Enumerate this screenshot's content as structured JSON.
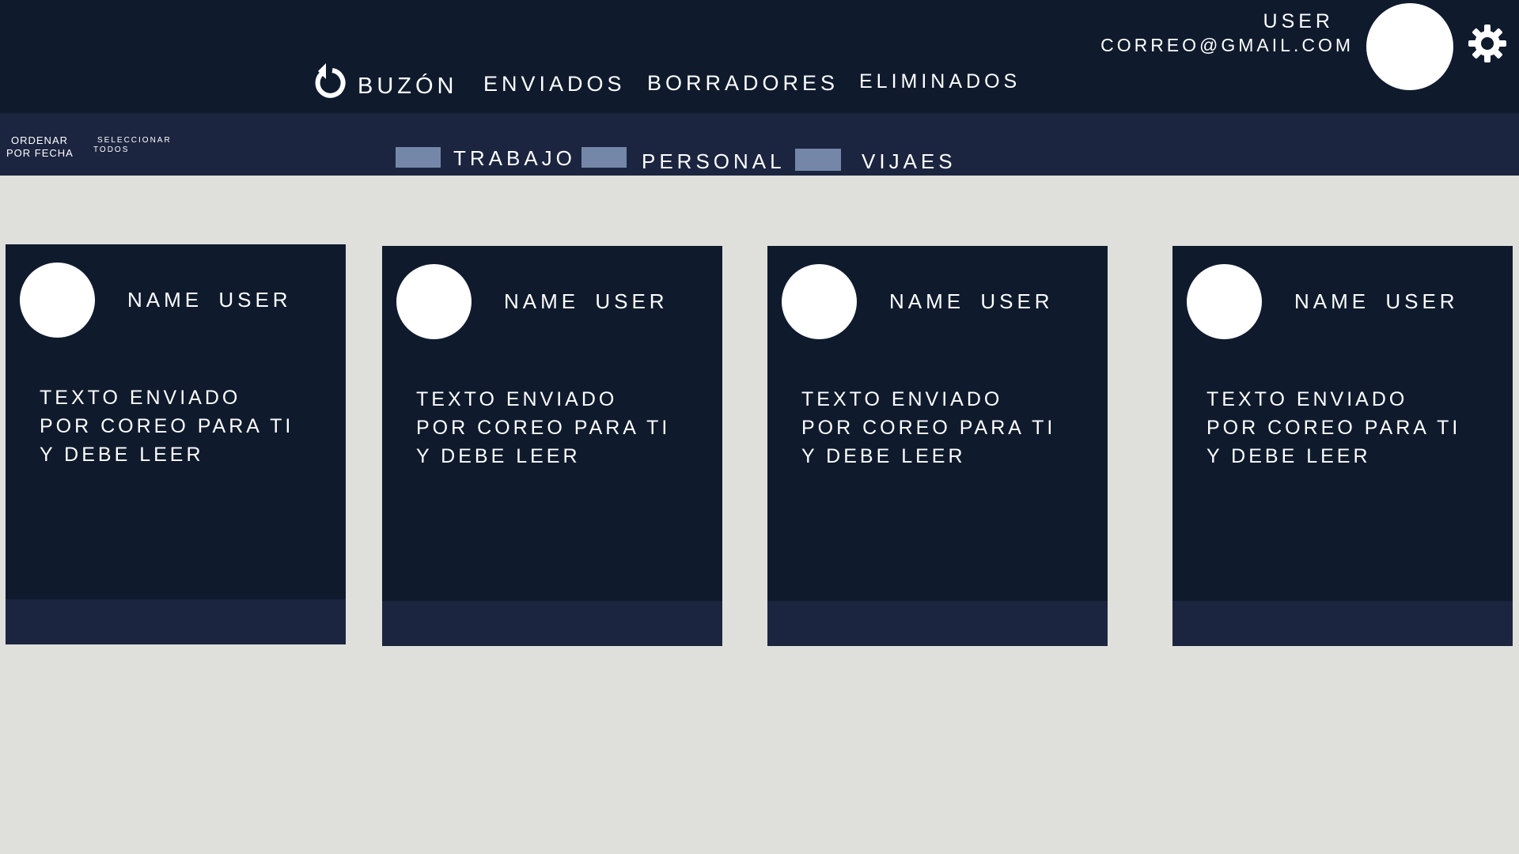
{
  "header": {
    "nav": [
      {
        "label": "BUZÓN"
      },
      {
        "label": "ENVIADOS"
      },
      {
        "label": "BORRADORES"
      },
      {
        "label": "ELIMINADOS"
      }
    ],
    "user": {
      "name": "USER",
      "email": "CORREO@GMAIL.COM"
    }
  },
  "toolbar": {
    "order": {
      "line1": "ORDENAR",
      "line2": "POR FECHA"
    },
    "select_all": {
      "line1": "SELECCIONAR",
      "line2": "TODOS"
    },
    "labels": [
      {
        "label": "TRABAJO",
        "color": "#7487a8"
      },
      {
        "label": "PERSONAL",
        "color": "#7487a8"
      },
      {
        "label": "VIJAES",
        "color": "#7487a8"
      }
    ]
  },
  "emails": [
    {
      "sender": "NAME USER",
      "lines": [
        "TEXTO ENVIADO",
        "POR COREO PARA TI",
        "Y DEBE LEER"
      ]
    },
    {
      "sender": "NAME USER",
      "lines": [
        "TEXTO ENVIADO",
        "POR COREO PARA TI",
        "Y DEBE LEER"
      ]
    },
    {
      "sender": "NAME USER",
      "lines": [
        "TEXTO ENVIADO",
        "POR COREO PARA TI",
        "Y DEBE LEER"
      ]
    },
    {
      "sender": "NAME USER",
      "lines": [
        "TEXTO ENVIADO",
        "POR COREO PARA TI",
        "Y DEBE LEER"
      ]
    }
  ],
  "colors": {
    "background": "#dfe0dc",
    "header": "#0f1b2d",
    "toolbar": "#1c2540",
    "card": "#0f1b2d",
    "card_footer": "#1c2540",
    "label_chip": "#7487a8"
  },
  "icons": {
    "refresh": "refresh-icon",
    "settings": "gear-icon"
  }
}
